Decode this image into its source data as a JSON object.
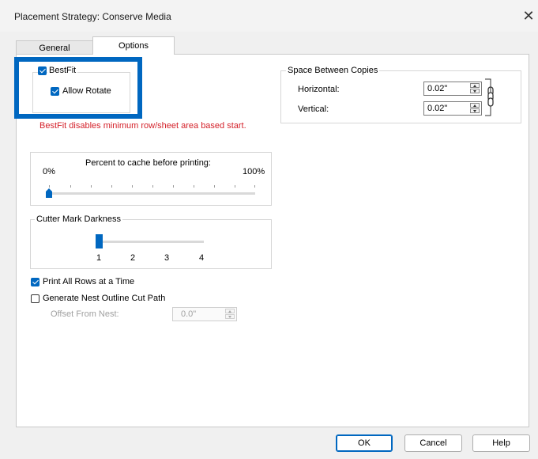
{
  "window": {
    "title": "Placement Strategy: Conserve Media",
    "close_glyph": "✕"
  },
  "tabs": [
    {
      "label": "General"
    },
    {
      "label": "Options"
    }
  ],
  "bestfit": {
    "label": "BestFit",
    "checked": true,
    "allow_rotate_label": "Allow Rotate",
    "allow_rotate_checked": true,
    "warning": "BestFit disables minimum row/sheet area based start."
  },
  "cache": {
    "label": "Percent to cache before printing:",
    "min_label": "0%",
    "max_label": "100%",
    "value_percent": 0
  },
  "cutter": {
    "label": "Cutter Mark Darkness",
    "ticks": [
      "1",
      "2",
      "3",
      "4"
    ],
    "value": 1
  },
  "print_all_rows": {
    "label": "Print All Rows at a Time",
    "checked": true
  },
  "nest_outline": {
    "label": "Generate Nest Outline Cut Path",
    "checked": false,
    "offset_label": "Offset From Nest:",
    "offset_value": "0.0\""
  },
  "spacing": {
    "label": "Space Between Copies",
    "horizontal_label": "Horizontal:",
    "horizontal_value": "0.02\"",
    "vertical_label": "Vertical:",
    "vertical_value": "0.02\"",
    "link_icon": "chain-link-icon"
  },
  "buttons": {
    "ok": "OK",
    "cancel": "Cancel",
    "help": "Help"
  },
  "colors": {
    "accent": "#0067c0",
    "warning": "#d4212a"
  }
}
